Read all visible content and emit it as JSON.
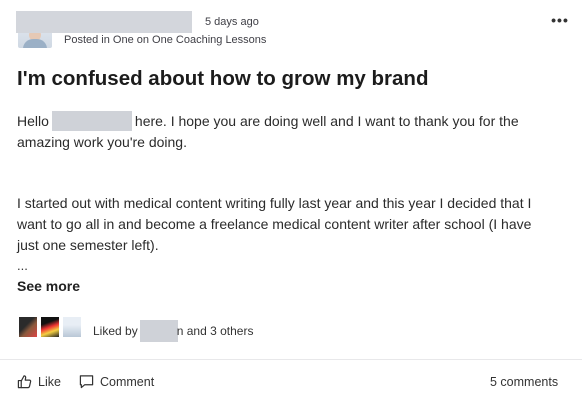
{
  "post": {
    "time_ago": "5 days ago",
    "posted_in": "Posted in One on One Coaching Lessons",
    "more_menu": "•••",
    "title": "I'm confused about how to grow my brand",
    "body": {
      "greeting_prefix": "Hello",
      "greeting_suffix": "here. I hope you are doing well and I want to thank you for the",
      "greeting_line2": "amazing work you're doing.",
      "para2_line1": "I started out with medical content writing fully last year and this year I decided that I",
      "para2_line2": "want to go all in and become a freelance medical content writer after school (I have",
      "para2_line3": "just one semester left).",
      "ellipsis": "...",
      "see_more": "See more"
    },
    "likes": {
      "prefix": "Liked by",
      "partial_name_tail": "n",
      "suffix": "and 3 others"
    },
    "actions": {
      "like": "Like",
      "comment": "Comment",
      "comments_count": "5 comments"
    }
  },
  "icons": {
    "like": "thumbs-up-icon",
    "comment": "speech-bubble-icon",
    "more": "ellipsis-horizontal-icon"
  }
}
